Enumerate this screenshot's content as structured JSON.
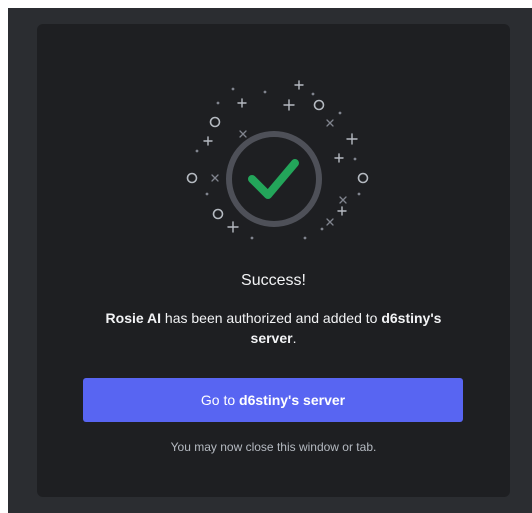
{
  "dialog": {
    "title": "Success!",
    "message": {
      "app_name": "Rosie AI",
      "middle_text": " has been authorized and added to ",
      "server_owner": "d6stiny's",
      "server_word": " server",
      "end_punct": "."
    },
    "button": {
      "prefix": "Go to ",
      "server_name": "d6stiny's server"
    },
    "hint": "You may now close this window or tab."
  },
  "colors": {
    "page_bg": "#2b2d31",
    "card_bg": "#1e1f22",
    "accent": "#5865f2",
    "success": "#23a55a"
  },
  "icons": [
    "checkmark-icon",
    "sparkle-icon",
    "ring-icon",
    "cross-icon"
  ]
}
